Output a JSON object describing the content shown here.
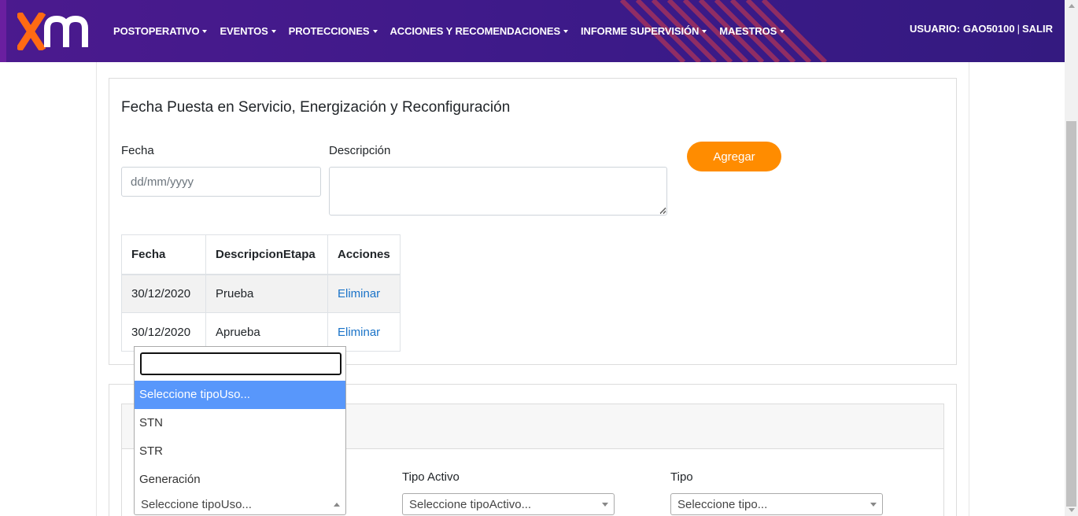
{
  "header": {
    "logo_alt": "xm",
    "menu": [
      {
        "label": "POSTOPERATIVO"
      },
      {
        "label": "EVENTOS"
      },
      {
        "label": "PROTECCIONES"
      },
      {
        "label": "ACCIONES Y RECOMENDACIONES"
      },
      {
        "label": "INFORME SUPERVISIÓN"
      },
      {
        "label": "MAESTROS"
      }
    ],
    "user_label": "USUARIO: GAO50100",
    "separator": "|",
    "logout_label": "SALIR"
  },
  "colors": {
    "navbar": "#3d1a8a",
    "accent_orange": "#ff8c00",
    "link": "#1a73c8",
    "dropdown_highlight": "#5897fb"
  },
  "section": {
    "title": "Fecha Puesta en Servicio, Energización y Reconfiguración",
    "fecha_label": "Fecha",
    "fecha_placeholder": "dd/mm/yyyy",
    "descripcion_label": "Descripción",
    "agregar_label": "Agregar"
  },
  "table": {
    "headers": [
      "Fecha",
      "DescripcionEtapa",
      "Acciones"
    ],
    "rows": [
      {
        "fecha": "30/12/2020",
        "descripcion": "Prueba",
        "accion": "Eliminar"
      },
      {
        "fecha": "30/12/2020",
        "descripcion": "Aprueba",
        "accion": "Eliminar"
      }
    ]
  },
  "form2": {
    "tipo_uso": {
      "selected": "Seleccione tipoUso...",
      "options": [
        "Seleccione tipoUso...",
        "STN",
        "STR",
        "Generación"
      ],
      "highlighted_index": 0
    },
    "tipo_activo": {
      "label": "Tipo Activo",
      "selected": "Seleccione tipoActivo..."
    },
    "tipo": {
      "label": "Tipo",
      "selected": "Seleccione tipo..."
    }
  },
  "icons": {
    "logo": "xm-logo",
    "menu_caret": "caret-down-icon",
    "select_arrow": "chevron-down-icon"
  }
}
